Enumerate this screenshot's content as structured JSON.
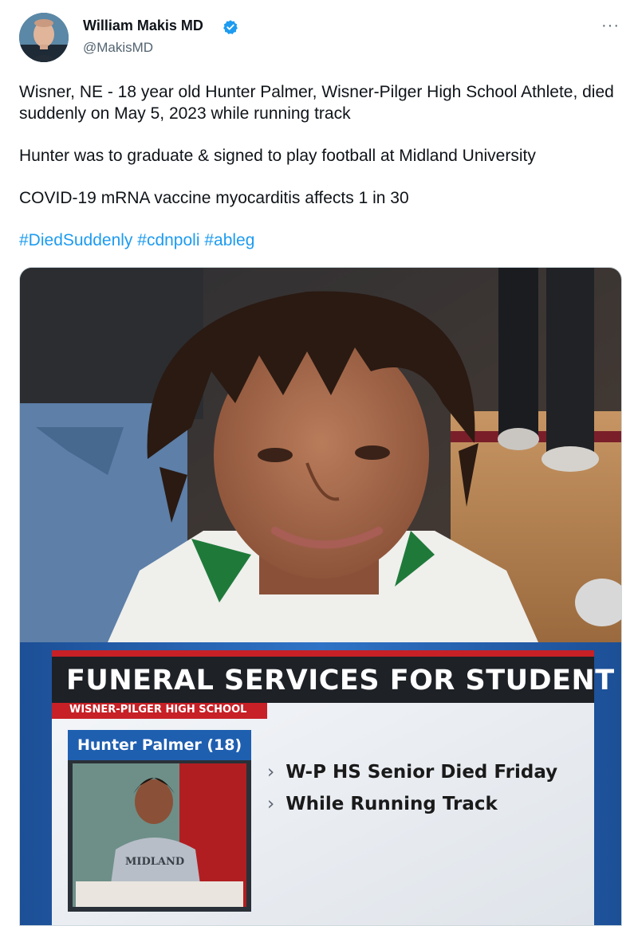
{
  "author": {
    "name": "William Makis MD",
    "handle": "@MakisMD",
    "verified": true
  },
  "more_menu_label": "···",
  "tweet": {
    "paragraphs": [
      "Wisner, NE - 18 year old Hunter Palmer, Wisner-Pilger High School Athlete, died suddenly on May 5, 2023 while running track",
      "Hunter was to graduate & signed to play football at Midland University",
      "COVID-19 mRNA vaccine myocarditis affects 1 in 30"
    ],
    "hashtags": "#DiedSuddenly #cdnpoli #ableg"
  },
  "media": {
    "broadcast": {
      "headline": "FUNERAL SERVICES FOR STUDENT",
      "subhead": "WISNER-PILGER HIGH SCHOOL",
      "name_tag": "Hunter Palmer (18)",
      "bullets": [
        "W-P HS Senior Died Friday",
        "While Running Track"
      ],
      "sweatshirt_text": "MIDLAND"
    }
  },
  "colors": {
    "link": "#1d9bf0",
    "broadcast_blue": "#1f5fb0",
    "broadcast_red": "#d21f26",
    "verified": "#1d9bf0"
  }
}
